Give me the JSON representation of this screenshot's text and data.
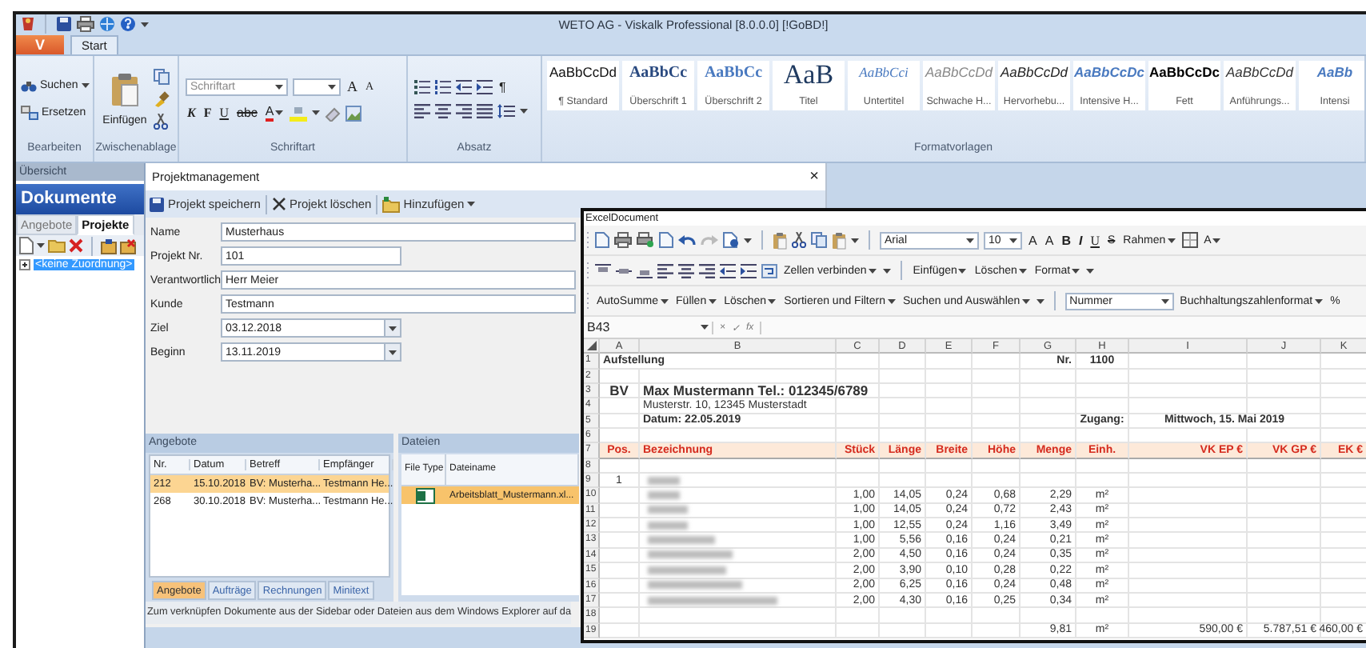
{
  "window": {
    "title": "WETO AG - Viskalk Professional [8.0.0.0] [!GoBD!]"
  },
  "app_button": {
    "label": "V"
  },
  "ribbon_tabs": [
    {
      "label": "Start",
      "selected": true
    }
  ],
  "ribbon": {
    "bearbeiten": {
      "caption": "Bearbeiten",
      "buttons": [
        {
          "label": "Suchen",
          "kind": "menu"
        },
        {
          "label": "Ersetzen",
          "kind": "plain"
        }
      ]
    },
    "zwischenablage": {
      "caption": "Zwischenablage",
      "paste": "Einfügen"
    },
    "schriftart": {
      "caption": "Schriftart",
      "font_placeholder": "Schriftart",
      "buttons_1": [
        {
          "label": "A",
          "kind": "grow"
        },
        {
          "label": "A",
          "kind": "shrink"
        }
      ],
      "buttons_2": [
        {
          "label": "K",
          "kind": "italic"
        },
        {
          "label": "F",
          "kind": "bold"
        },
        {
          "label": "U",
          "kind": "underline"
        },
        {
          "label": "abc",
          "kind": "strike"
        },
        {
          "label": "A",
          "kind": "color"
        }
      ]
    },
    "absatz": {
      "caption": "Absatz",
      "pilcrow": "¶"
    },
    "formatvorlagen": {
      "caption": "Formatvorlagen",
      "styles": [
        {
          "sample": "AaBbCcDd",
          "label": "¶ Standard",
          "kind": "standard"
        },
        {
          "sample": "AaBbCc",
          "label": "Überschrift 1",
          "kind": "heading1"
        },
        {
          "sample": "AaBbCc",
          "label": "Überschrift 2",
          "kind": "heading2"
        },
        {
          "sample": "AaB",
          "label": "Titel",
          "kind": "title"
        },
        {
          "sample": "AaBbCci",
          "label": "Untertitel",
          "kind": "subtitle"
        },
        {
          "sample": "AaBbCcDd",
          "label": "Schwache H...",
          "kind": "subtle"
        },
        {
          "sample": "AaBbCcDd",
          "label": "Hervorhebu...",
          "kind": "emphasis"
        },
        {
          "sample": "AaBbCcDc",
          "label": "Intensive H...",
          "kind": "intense"
        },
        {
          "sample": "AaBbCcDc",
          "label": "Fett",
          "kind": "strong"
        },
        {
          "sample": "AaBbCcDd",
          "label": "Anführungs...",
          "kind": "quote"
        },
        {
          "sample": "AaBb",
          "label": "Intensi",
          "kind": "intense"
        }
      ]
    }
  },
  "sidebar": {
    "header": "Übersicht",
    "title": "Dokumente",
    "tabs": [
      {
        "label": "Angebote",
        "selected": false
      },
      {
        "label": "Projekte",
        "selected": true
      }
    ],
    "tree": [
      {
        "label": "<keine Zuordnung>",
        "selected": true,
        "expanded": false
      }
    ]
  },
  "project": {
    "title": "Projektmanagement",
    "close": "×",
    "toolbar": [
      {
        "label": "Projekt speichern",
        "kind": "save"
      },
      {
        "label": "Projekt löschen",
        "kind": "delete"
      },
      {
        "label": "Hinzufügen",
        "kind": "add"
      }
    ],
    "fields": [
      {
        "label": "Name",
        "value": "Musterhaus",
        "kind": "text"
      },
      {
        "label": "Projekt Nr.",
        "value": "101",
        "kind": "short"
      },
      {
        "label": "Verantwortlich",
        "value": "Herr Meier",
        "kind": "text"
      },
      {
        "label": "Kunde",
        "value": "Testmann",
        "kind": "text"
      },
      {
        "label": "Ziel",
        "value": "03.12.2018",
        "kind": "date"
      },
      {
        "label": "Beginn",
        "value": "13.11.2019",
        "kind": "date"
      }
    ],
    "offers": {
      "title": "Angebote",
      "columns": [
        "Nr.",
        "Datum",
        "Betreff",
        "Empfänger"
      ],
      "rows": [
        {
          "cells": [
            "212",
            "15.10.2018",
            "BV: Musterha...",
            "Testmann He..."
          ],
          "selected": true
        },
        {
          "cells": [
            "268",
            "30.10.2018",
            "BV: Musterha...",
            "Testmann He..."
          ],
          "selected": false
        }
      ],
      "tabs": [
        {
          "label": "Angebote",
          "selected": true
        },
        {
          "label": "Aufträge",
          "selected": false
        },
        {
          "label": "Rechnungen",
          "selected": false
        },
        {
          "label": "Minitext",
          "selected": false
        }
      ]
    },
    "files": {
      "title": "Dateien",
      "columns": [
        "File Type",
        "Dateiname"
      ],
      "rows": [
        {
          "name": "Arbeitsblatt_Mustermann.xl...",
          "selected": true
        }
      ]
    },
    "hint": "Zum verknüpfen Dokumente aus der Sidebar oder Dateien aus dem Windows Explorer auf da"
  },
  "excel": {
    "title": "ExcelDocument",
    "toolbar_1": {
      "font": "Arial",
      "size": "10",
      "buttons": [
        {
          "label": "A",
          "kind": "grow"
        },
        {
          "label": "A",
          "kind": "shrink"
        },
        {
          "label": "B",
          "kind": "bold"
        },
        {
          "label": "I",
          "kind": "italic"
        },
        {
          "label": "U",
          "kind": "underline"
        },
        {
          "label": "S",
          "kind": "strike"
        },
        {
          "label": "Rahmen",
          "kind": "menu"
        }
      ],
      "buttons_end": [
        {
          "label": "A",
          "kind": "menu"
        }
      ]
    },
    "toolbar_2": {
      "buttons": [
        {
          "label": "Zellen verbinden",
          "kind": "menu"
        }
      ],
      "buttons_end": [
        {
          "label": "Einfügen",
          "kind": "menu"
        },
        {
          "label": "Löschen",
          "kind": "menu"
        },
        {
          "label": "Format",
          "kind": "menu"
        }
      ]
    },
    "toolbar_3": {
      "buttons": [
        {
          "label": "AutoSumme",
          "kind": "menu"
        },
        {
          "label": "Füllen",
          "kind": "menu"
        },
        {
          "label": "Löschen",
          "kind": "menu"
        },
        {
          "label": "Sortieren und Filtern",
          "kind": "menu"
        },
        {
          "label": "Suchen und Auswählen",
          "kind": "menu"
        }
      ],
      "number_format": "Nummer",
      "buttons_end": [
        {
          "label": "Buchhaltungszahlenformat",
          "kind": "menu"
        },
        {
          "label": "%",
          "kind": "plain"
        }
      ]
    },
    "name_box": "B43",
    "formula_buttons": [
      "×",
      "✓",
      "fx"
    ],
    "columns": [
      "A",
      "B",
      "C",
      "D",
      "E",
      "F",
      "G",
      "H",
      "I",
      "J",
      "K"
    ],
    "rows": [
      {
        "num": "1",
        "kind": "bold",
        "cells": [
          "Aufstellung",
          "",
          "",
          "",
          "",
          "",
          "Nr.",
          "1100",
          "",
          "",
          ""
        ]
      },
      {
        "num": "2",
        "kind": "plain",
        "cells": [
          "",
          "",
          "",
          "",
          "",
          "",
          "",
          "",
          "",
          "",
          ""
        ]
      },
      {
        "num": "3",
        "kind": "big",
        "cells": [
          "BV",
          "Max Mustermann Tel.: 012345/6789",
          "",
          "",
          "",
          "",
          "",
          "",
          "",
          "",
          ""
        ]
      },
      {
        "num": "4",
        "kind": "plain",
        "cells": [
          "",
          "Musterstr. 10, 12345 Musterstadt",
          "",
          "",
          "",
          "",
          "",
          "",
          "",
          "",
          ""
        ]
      },
      {
        "num": "5",
        "kind": "bold",
        "cells": [
          "",
          "Datum: 22.05.2019",
          "",
          "",
          "",
          "",
          "",
          "Zugang:",
          "Mittwoch, 15. Mai 2019",
          "",
          ""
        ]
      },
      {
        "num": "6",
        "kind": "plain",
        "cells": [
          "",
          "",
          "",
          "",
          "",
          "",
          "",
          "",
          "",
          "",
          ""
        ]
      },
      {
        "num": "7",
        "kind": "header",
        "cells": [
          "Pos.",
          "Bezeichnung",
          "Stück",
          "Länge",
          "Breite",
          "Höhe",
          "Menge",
          "Einh.",
          "VK EP €",
          "VK GP €",
          "EK €"
        ]
      },
      {
        "num": "8",
        "kind": "plain",
        "cells": [
          "",
          "",
          "",
          "",
          "",
          "",
          "",
          "",
          "",
          "",
          ""
        ]
      },
      {
        "num": "9",
        "kind": "plain",
        "blurred": true,
        "cells": [
          "1",
          "",
          "",
          "",
          "",
          "",
          "",
          "",
          "",
          "",
          ""
        ]
      },
      {
        "num": "10",
        "kind": "plain",
        "blurred": true,
        "cells": [
          "",
          "",
          "1,00",
          "14,05",
          "0,24",
          "0,68",
          "2,29",
          "m²",
          "",
          "",
          ""
        ]
      },
      {
        "num": "11",
        "kind": "plain",
        "blurred": true,
        "cells": [
          "",
          "",
          "1,00",
          "14,05",
          "0,24",
          "0,72",
          "2,43",
          "m²",
          "",
          "",
          ""
        ]
      },
      {
        "num": "12",
        "kind": "plain",
        "blurred": true,
        "cells": [
          "",
          "",
          "1,00",
          "12,55",
          "0,24",
          "1,16",
          "3,49",
          "m²",
          "",
          "",
          ""
        ]
      },
      {
        "num": "13",
        "kind": "plain",
        "blurred": true,
        "cells": [
          "",
          "",
          "1,00",
          "5,56",
          "0,16",
          "0,24",
          "0,21",
          "m²",
          "",
          "",
          ""
        ]
      },
      {
        "num": "14",
        "kind": "plain",
        "blurred": true,
        "cells": [
          "",
          "",
          "2,00",
          "4,50",
          "0,16",
          "0,24",
          "0,35",
          "m²",
          "",
          "",
          ""
        ]
      },
      {
        "num": "15",
        "kind": "plain",
        "blurred": true,
        "cells": [
          "",
          "",
          "2,00",
          "3,90",
          "0,10",
          "0,28",
          "0,22",
          "m²",
          "",
          "",
          ""
        ]
      },
      {
        "num": "16",
        "kind": "plain",
        "blurred": true,
        "cells": [
          "",
          "",
          "2,00",
          "6,25",
          "0,16",
          "0,24",
          "0,48",
          "m²",
          "",
          "",
          ""
        ]
      },
      {
        "num": "17",
        "kind": "plain",
        "blurred": true,
        "cells": [
          "",
          "",
          "2,00",
          "4,30",
          "0,16",
          "0,25",
          "0,34",
          "m²",
          "",
          "",
          ""
        ]
      },
      {
        "num": "18",
        "kind": "plain",
        "cells": [
          "",
          "",
          "",
          "",
          "",
          "",
          "",
          "",
          "",
          "",
          ""
        ]
      },
      {
        "num": "19",
        "kind": "plain",
        "cells": [
          "",
          "",
          "",
          "",
          "",
          "",
          "9,81",
          "m²",
          "590,00 €",
          "5.787,51 €",
          "460,00 €"
        ]
      }
    ]
  }
}
